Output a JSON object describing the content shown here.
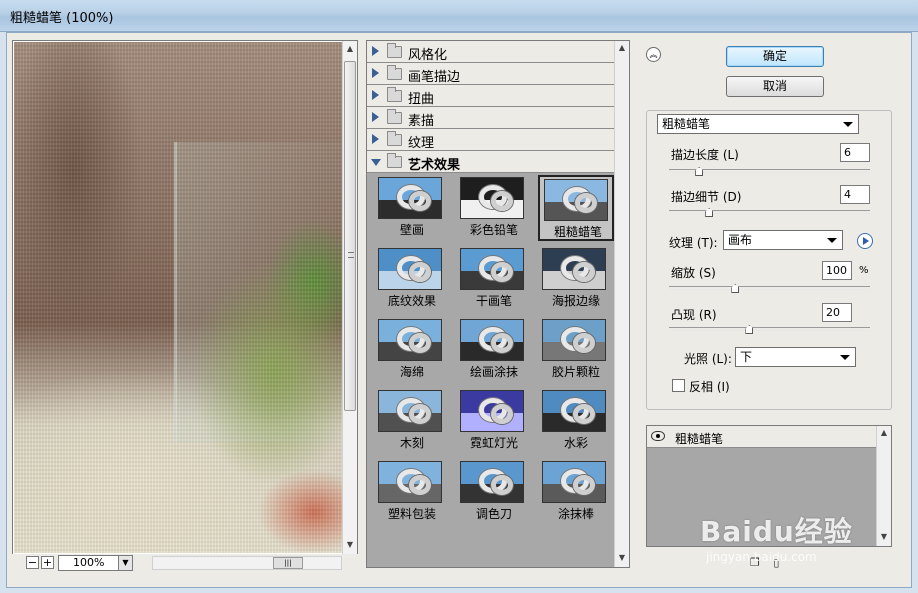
{
  "window": {
    "title": "粗糙蜡笔 (100%)"
  },
  "preview": {
    "zoom": "100%",
    "zoom_out": "−",
    "zoom_in": "+"
  },
  "gallery": {
    "categories": [
      {
        "label": "风格化",
        "open": false
      },
      {
        "label": "画笔描边",
        "open": false
      },
      {
        "label": "扭曲",
        "open": false
      },
      {
        "label": "素描",
        "open": false
      },
      {
        "label": "纹理",
        "open": false
      },
      {
        "label": "艺术效果",
        "open": true
      }
    ],
    "filters": [
      {
        "label": "壁画"
      },
      {
        "label": "彩色铅笔"
      },
      {
        "label": "粗糙蜡笔",
        "selected": true
      },
      {
        "label": "底纹效果"
      },
      {
        "label": "干画笔"
      },
      {
        "label": "海报边缘"
      },
      {
        "label": "海绵"
      },
      {
        "label": "绘画涂抹"
      },
      {
        "label": "胶片颗粒"
      },
      {
        "label": "木刻"
      },
      {
        "label": "霓虹灯光"
      },
      {
        "label": "水彩"
      },
      {
        "label": "塑料包装"
      },
      {
        "label": "调色刀"
      },
      {
        "label": "涂抹棒"
      }
    ]
  },
  "buttons": {
    "ok": "确定",
    "cancel": "取消"
  },
  "settings": {
    "filter_select": "粗糙蜡笔",
    "stroke_length": {
      "label": "描边长度 (L)",
      "value": "6",
      "fraction": 0.15
    },
    "stroke_detail": {
      "label": "描边细节 (D)",
      "value": "4",
      "fraction": 0.2
    },
    "texture": {
      "label": "纹理 (T):",
      "value": "画布"
    },
    "scaling": {
      "label": "缩放 (S)",
      "value": "100",
      "unit": "%",
      "fraction": 0.33
    },
    "relief": {
      "label": "凸现 (R)",
      "value": "20",
      "fraction": 0.4
    },
    "light": {
      "label": "光照 (L):",
      "value": "下"
    },
    "invert": {
      "label": "反相 (I)",
      "checked": false
    }
  },
  "layers": [
    {
      "label": "粗糙蜡笔",
      "visible": true
    }
  ],
  "watermark": {
    "brand": "Baidu经验",
    "url": "jingyan.baidu.com"
  },
  "colors": {
    "accent": "#3b5e93",
    "titlebar": "#b7cfe6",
    "panel": "#ecebe6"
  }
}
